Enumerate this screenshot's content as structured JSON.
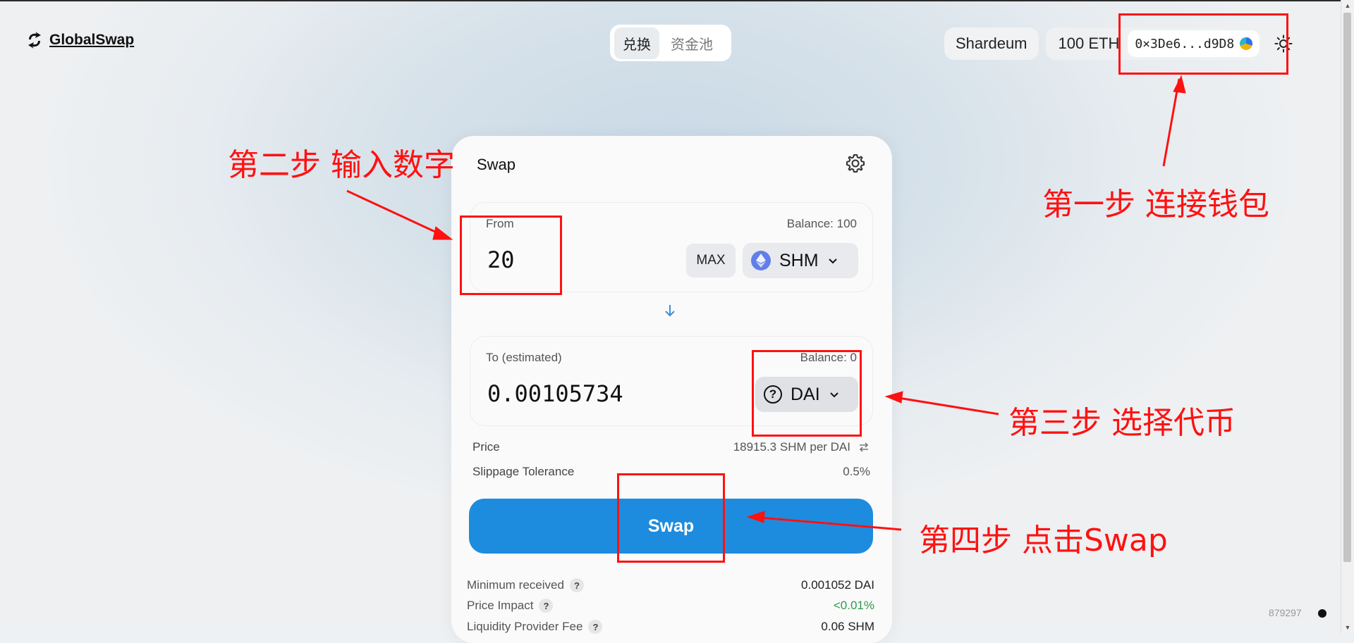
{
  "header": {
    "logo_text": "GlobalSwap",
    "nav_tabs": [
      "兑换",
      "资金池"
    ],
    "network": "Shardeum",
    "balance": "100 ETH",
    "address": "0×3De6...d9D8"
  },
  "card": {
    "title": "Swap",
    "from": {
      "label": "From",
      "balance": "Balance: 100",
      "amount": "20",
      "max_label": "MAX",
      "token": "SHM"
    },
    "to": {
      "label": "To (estimated)",
      "balance": "Balance: 0",
      "amount": "0.00105734",
      "token": "DAI"
    },
    "price_label": "Price",
    "price_value": "18915.3 SHM per DAI",
    "slippage_label": "Slippage Tolerance",
    "slippage_value": "0.5%",
    "swap_button": "Swap",
    "details": [
      {
        "label": "Minimum received",
        "value": "0.001052 DAI"
      },
      {
        "label": "Price Impact",
        "value": "<0.01%"
      },
      {
        "label": "Liquidity Provider Fee",
        "value": "0.06 SHM"
      }
    ]
  },
  "footer": {
    "block_number": "879297"
  },
  "annotations": {
    "step1": "第一步 连接钱包",
    "step2": "第二步 输入数字",
    "step3": "第三步 选择代币",
    "step4": "第四步 点击Swap"
  },
  "colors": {
    "accent": "#1d8cdf",
    "annotation": "#ff1111",
    "positive": "#2e9a4a"
  }
}
